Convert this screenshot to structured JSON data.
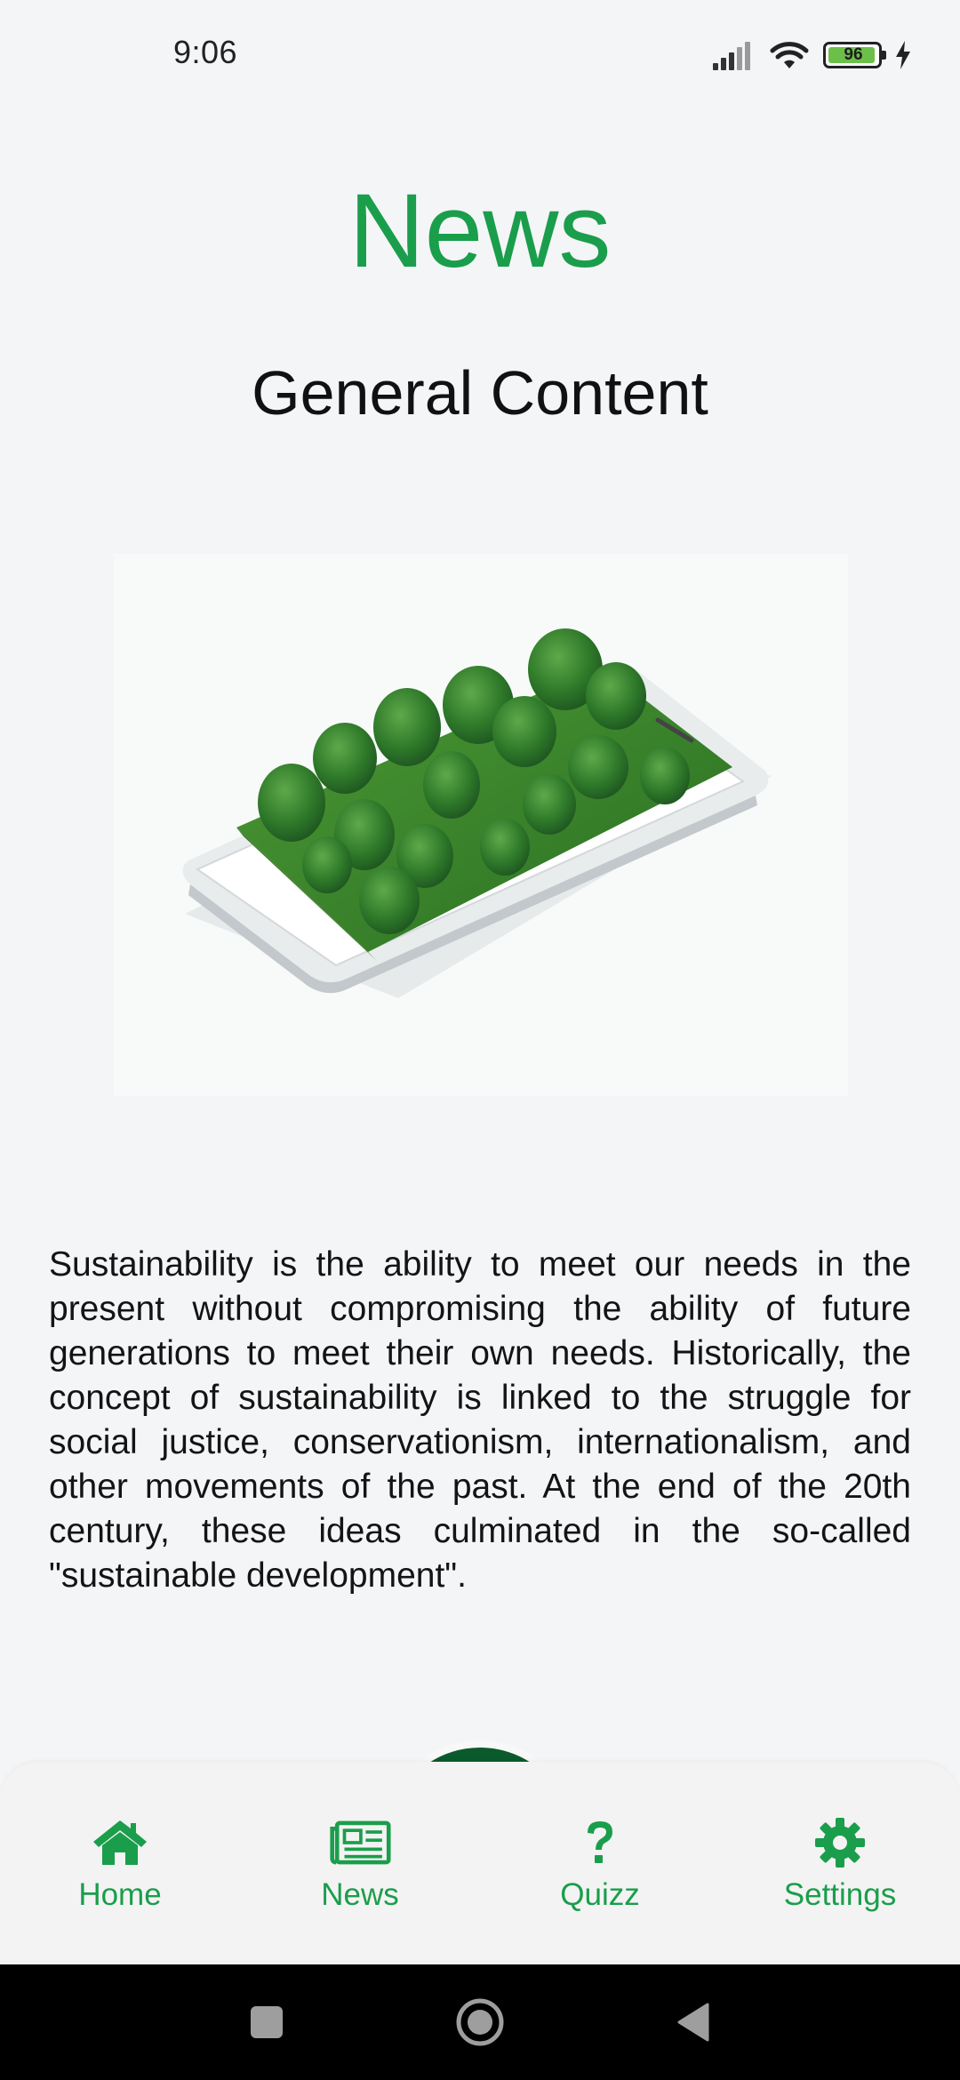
{
  "status_bar": {
    "time": "9:06",
    "battery_level": "96",
    "icons": [
      "signal-icon",
      "wifi-icon",
      "battery-icon",
      "charging-icon"
    ]
  },
  "page": {
    "title": "News",
    "section_title": "General Content",
    "hero_image": "smartphone-with-forest-image",
    "article": "Sustainability is the ability to meet our needs in the present without compromising the ability of future generations to meet their own needs. Historically, the concept of sustainability is linked to the struggle for social justice, conservationism, internationalism, and other movements of the past. At the end of the 20th century, these ideas culminated in the so-called \"sustainable development\"."
  },
  "bottom_nav": {
    "items": [
      {
        "label": "Home",
        "icon": "home-icon"
      },
      {
        "label": "News",
        "icon": "newspaper-icon"
      },
      {
        "label": "Quizz",
        "icon": "question-mark-icon"
      },
      {
        "label": "Settings",
        "icon": "gear-icon"
      }
    ],
    "active": "News"
  },
  "colors": {
    "accent": "#1a9e4b",
    "fab": "#0b5a2b",
    "background": "#f4f5f7"
  }
}
